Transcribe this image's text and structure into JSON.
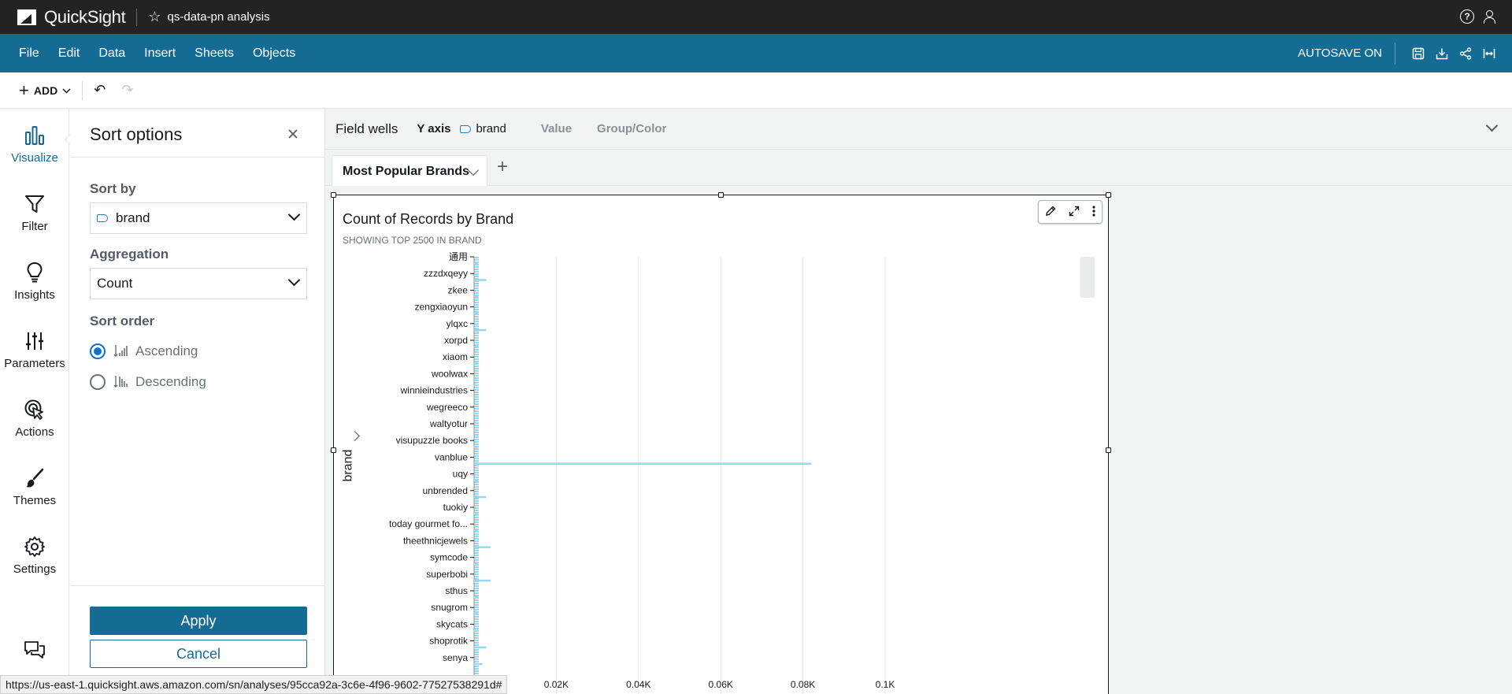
{
  "topbar": {
    "app_name": "QuickSight",
    "analysis_name": "qs-data-pn analysis"
  },
  "menubar": {
    "items": [
      "File",
      "Edit",
      "Data",
      "Insert",
      "Sheets",
      "Objects"
    ],
    "autosave": "AUTOSAVE ON"
  },
  "toolbar": {
    "add_label": "ADD"
  },
  "leftnav": {
    "items": [
      {
        "label": "Visualize",
        "icon": "bar-chart-icon",
        "active": true
      },
      {
        "label": "Filter",
        "icon": "filter-icon"
      },
      {
        "label": "Insights",
        "icon": "lightbulb-icon"
      },
      {
        "label": "Parameters",
        "icon": "sliders-icon"
      },
      {
        "label": "Actions",
        "icon": "cursor-click-icon"
      },
      {
        "label": "Themes",
        "icon": "brush-icon"
      },
      {
        "label": "Settings",
        "icon": "gear-icon"
      }
    ]
  },
  "sort_panel": {
    "title": "Sort options",
    "sort_by_label": "Sort by",
    "sort_by_value": "brand",
    "aggregation_label": "Aggregation",
    "aggregation_value": "Count",
    "sort_order_label": "Sort order",
    "ascending": "Ascending",
    "descending": "Descending",
    "selected_order": "Ascending",
    "apply": "Apply",
    "cancel": "Cancel"
  },
  "field_wells": {
    "title": "Field wells",
    "y_axis_label": "Y axis",
    "y_axis_field": "brand",
    "value_label": "Value",
    "group_label": "Group/Color"
  },
  "sheet": {
    "tab_name": "Most Popular Brands"
  },
  "visual": {
    "title": "Count of Records by Brand",
    "subtitle": "SHOWING TOP 2500 IN BRAND",
    "y_axis_title": "brand"
  },
  "chart_data": {
    "type": "bar",
    "orientation": "horizontal",
    "title": "Count of Records by Brand",
    "subtitle": "SHOWING TOP 2500 IN BRAND",
    "ylabel": "brand",
    "categories": [
      "通用",
      "zzzdxqeyy",
      "zkee",
      "zengxiaoyun",
      "ylqxc",
      "xorpd",
      "xiaom",
      "woolwax",
      "winnieindustries",
      "wegreeco",
      "waltyotur",
      "visupuzzle books",
      "vanblue",
      "uqy",
      "unbrended",
      "tuokiy",
      "today gourmet fo...",
      "theethnicjewels",
      "symcode",
      "superbobi",
      "sthus",
      "snugrom",
      "skycats",
      "shoprotik",
      "senya"
    ],
    "values": [
      1,
      3,
      1,
      1,
      3,
      1,
      1,
      1,
      1,
      1,
      1,
      1,
      82,
      1,
      3,
      1,
      1,
      4,
      1,
      4,
      1,
      1,
      1,
      3,
      2
    ],
    "xticks": [
      "0.02K",
      "0.04K",
      "0.06K",
      "0.08K",
      "0.1K"
    ],
    "xlim": [
      0,
      100
    ],
    "bar_color": "#9ad7ec"
  },
  "status_url": "https://us-east-1.quicksight.aws.amazon.com/sn/analyses/95cca92a-3c6e-4f96-9602-77527538291d#"
}
